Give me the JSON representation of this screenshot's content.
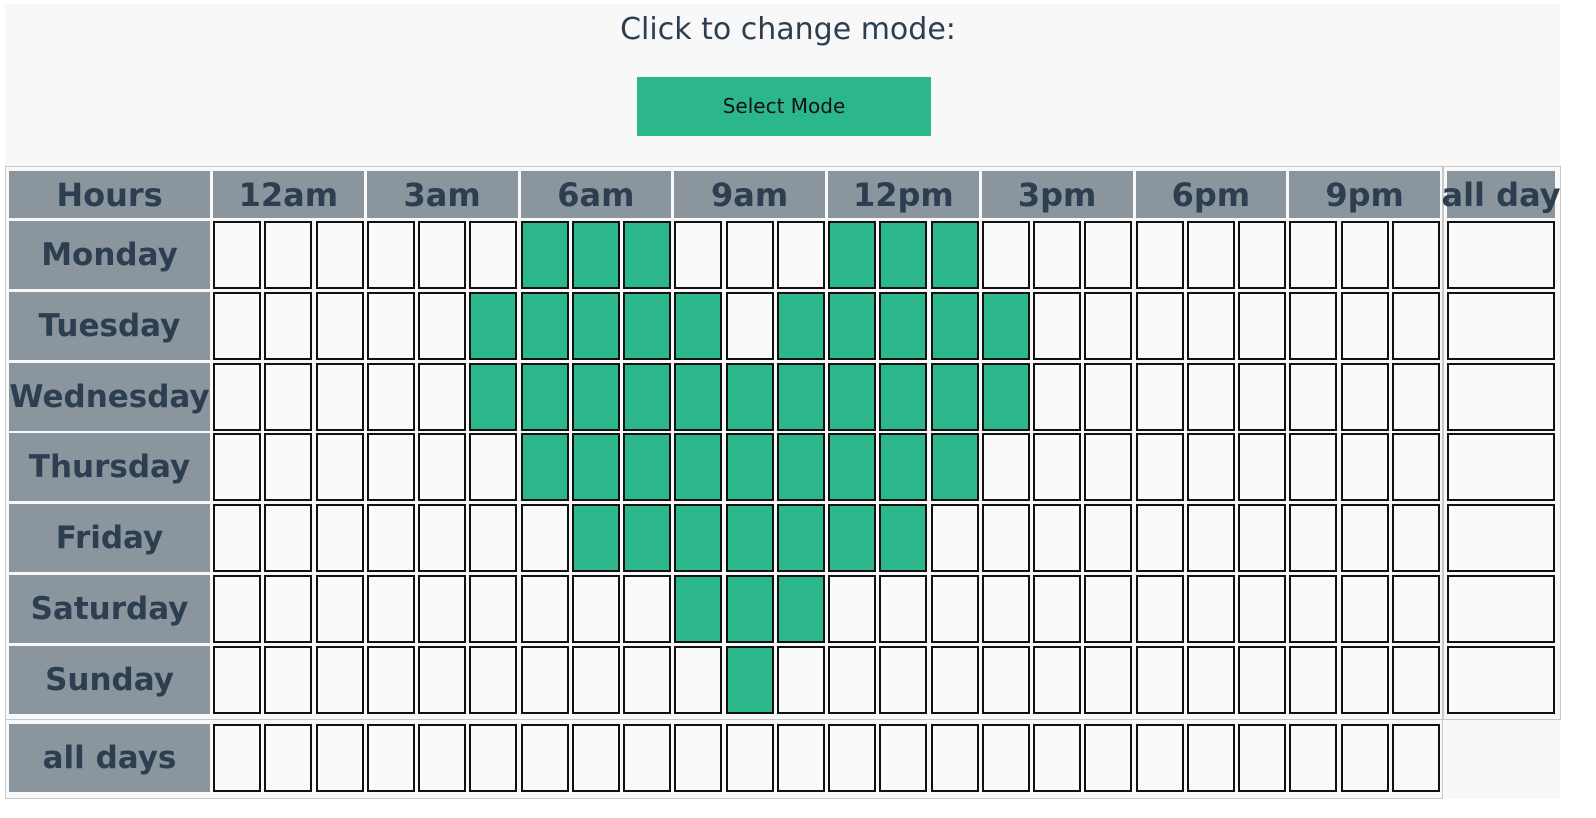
{
  "prompt": "Click to change mode:",
  "mode_button": "Select Mode",
  "colors": {
    "selected": "#2bb78b",
    "empty": "#fafafa",
    "header_bg": "#8a959e",
    "header_text": "#2d3e50"
  },
  "grid": {
    "corner_label": "Hours",
    "hour_labels": [
      "12am",
      "3am",
      "6am",
      "9am",
      "12pm",
      "3pm",
      "6pm",
      "9pm"
    ],
    "all_day_label": "all day",
    "all_days_label": "all days",
    "days": [
      {
        "label": "Monday",
        "hours": [
          0,
          0,
          0,
          0,
          0,
          0,
          1,
          1,
          1,
          0,
          0,
          0,
          1,
          1,
          1,
          0,
          0,
          0,
          0,
          0,
          0,
          0,
          0,
          0
        ]
      },
      {
        "label": "Tuesday",
        "hours": [
          0,
          0,
          0,
          0,
          0,
          1,
          1,
          1,
          1,
          1,
          0,
          1,
          1,
          1,
          1,
          1,
          0,
          0,
          0,
          0,
          0,
          0,
          0,
          0
        ]
      },
      {
        "label": "Wednesday",
        "hours": [
          0,
          0,
          0,
          0,
          0,
          1,
          1,
          1,
          1,
          1,
          1,
          1,
          1,
          1,
          1,
          1,
          0,
          0,
          0,
          0,
          0,
          0,
          0,
          0
        ]
      },
      {
        "label": "Thursday",
        "hours": [
          0,
          0,
          0,
          0,
          0,
          0,
          1,
          1,
          1,
          1,
          1,
          1,
          1,
          1,
          1,
          0,
          0,
          0,
          0,
          0,
          0,
          0,
          0,
          0
        ]
      },
      {
        "label": "Friday",
        "hours": [
          0,
          0,
          0,
          0,
          0,
          0,
          0,
          1,
          1,
          1,
          1,
          1,
          1,
          1,
          0,
          0,
          0,
          0,
          0,
          0,
          0,
          0,
          0,
          0
        ]
      },
      {
        "label": "Saturday",
        "hours": [
          0,
          0,
          0,
          0,
          0,
          0,
          0,
          0,
          0,
          1,
          1,
          1,
          0,
          0,
          0,
          0,
          0,
          0,
          0,
          0,
          0,
          0,
          0,
          0
        ]
      },
      {
        "label": "Sunday",
        "hours": [
          0,
          0,
          0,
          0,
          0,
          0,
          0,
          0,
          0,
          0,
          1,
          0,
          0,
          0,
          0,
          0,
          0,
          0,
          0,
          0,
          0,
          0,
          0,
          0
        ]
      }
    ],
    "all_days_hours": [
      0,
      0,
      0,
      0,
      0,
      0,
      0,
      0,
      0,
      0,
      0,
      0,
      0,
      0,
      0,
      0,
      0,
      0,
      0,
      0,
      0,
      0,
      0,
      0
    ],
    "all_day": [
      0,
      0,
      0,
      0,
      0,
      0,
      0
    ]
  }
}
